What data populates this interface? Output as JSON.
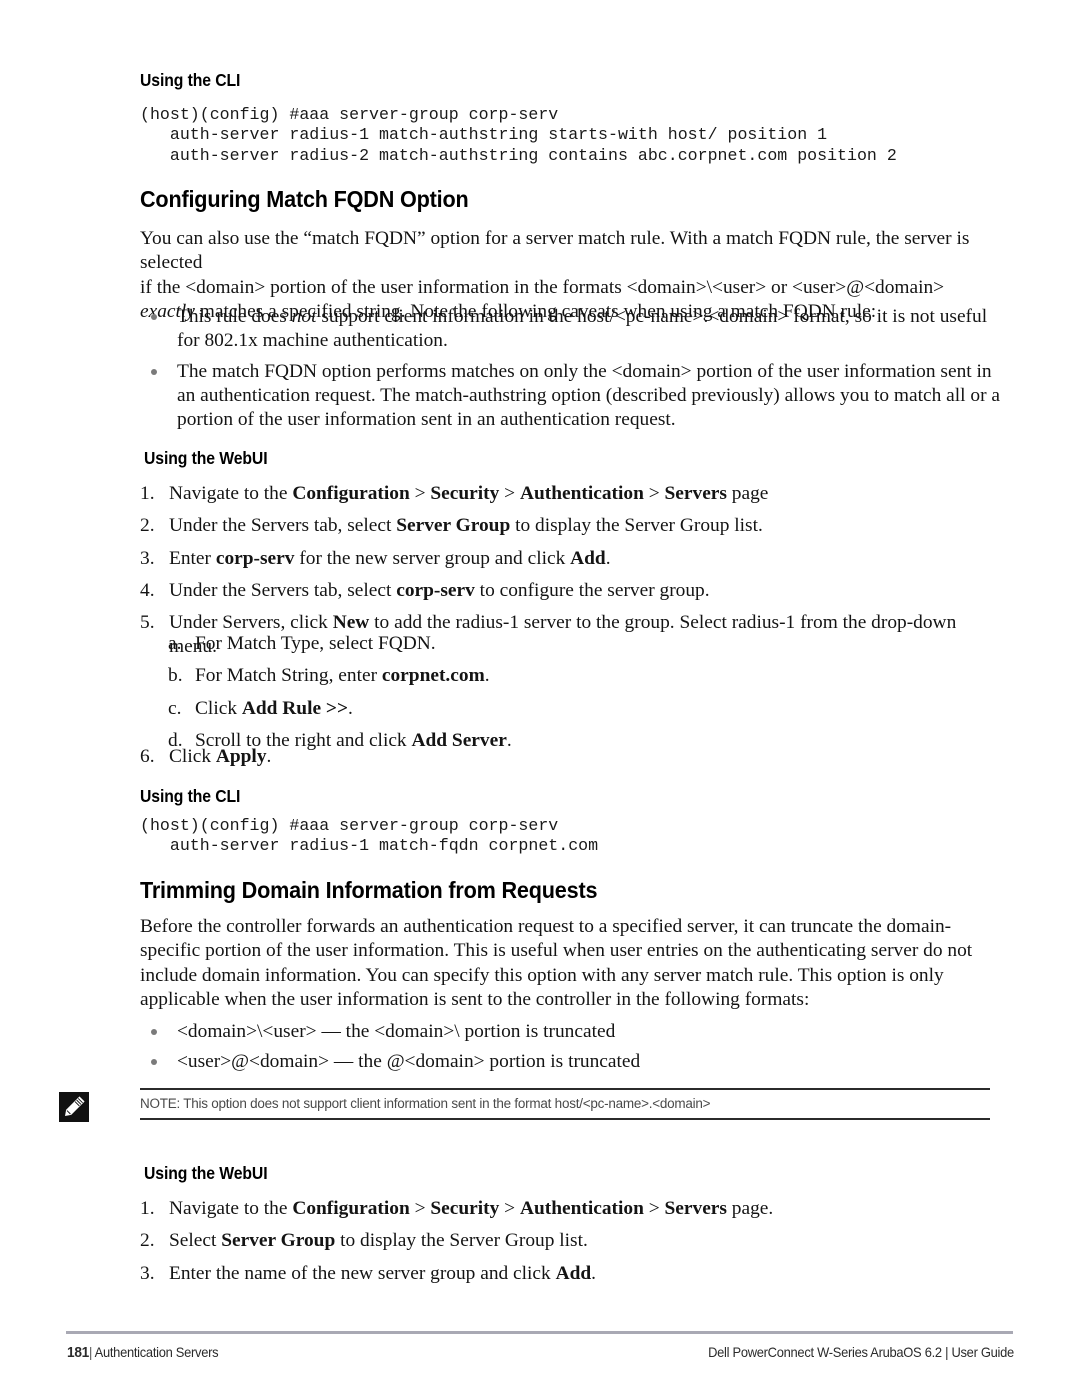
{
  "document": {
    "sections": [
      {
        "id": "cli-1",
        "heading": "Using the CLI",
        "code": "(host)(config) #aaa server-group corp-serv\n   auth-server radius-1 match-authstring starts-with host/ position 1\n   auth-server radius-2 match-authstring contains abc.corpnet.com position 2"
      },
      {
        "id": "fqdn",
        "heading": "Configuring Match FQDN Option",
        "intro_line1": "You can also use the “match FQDN” option for a server match rule. With a match FQDN rule, the server is selected",
        "intro_line2": "if the <domain> portion of the user information in the formats <domain>\\<user> or <user>@<domain>",
        "intro_line3_italic": "exactly",
        "intro_line3_rest": " matches a specified string. Note the following caveats when using a match FQDN rule:",
        "bullets": [
          {
            "pre": "This rule does ",
            "italic": "not",
            "post": " support client information in the host/<pc-name>.<domain> format, so it is not useful for 802.1x machine authentication."
          },
          {
            "pre": "The match FQDN option performs matches on only the <domain> portion of the user information sent in an authentication request. The match-authstring option (described previously) allows you to match all or a portion of the user information sent in an authentication request.",
            "italic": "",
            "post": ""
          }
        ]
      },
      {
        "id": "webui-1",
        "heading": "Using the WebUI",
        "steps": [
          {
            "marker": "1.",
            "parts": [
              {
                "t": "Navigate to the ",
                "s": "n"
              },
              {
                "t": "Configuration",
                "s": "b"
              },
              {
                "t": " > ",
                "s": "n"
              },
              {
                "t": "Security",
                "s": "b"
              },
              {
                "t": " > ",
                "s": "n"
              },
              {
                "t": "Authentication",
                "s": "b"
              },
              {
                "t": " > ",
                "s": "n"
              },
              {
                "t": "Servers",
                "s": "b"
              },
              {
                "t": " page",
                "s": "n"
              }
            ]
          },
          {
            "marker": "2.",
            "parts": [
              {
                "t": "Under the Servers tab, select ",
                "s": "n"
              },
              {
                "t": "Server Group",
                "s": "b"
              },
              {
                "t": " to display the Server Group list.",
                "s": "n"
              }
            ]
          },
          {
            "marker": "3.",
            "parts": [
              {
                "t": "Enter ",
                "s": "n"
              },
              {
                "t": "corp-serv",
                "s": "b"
              },
              {
                "t": " for the new server group and click ",
                "s": "n"
              },
              {
                "t": "Add",
                "s": "b"
              },
              {
                "t": ".",
                "s": "n"
              }
            ]
          },
          {
            "marker": "4.",
            "parts": [
              {
                "t": "Under the Servers tab, select ",
                "s": "n"
              },
              {
                "t": "corp-serv",
                "s": "b"
              },
              {
                "t": " to configure the server group.",
                "s": "n"
              }
            ]
          },
          {
            "marker": "5.",
            "parts": [
              {
                "t": "Under Servers, click ",
                "s": "n"
              },
              {
                "t": "New",
                "s": "b"
              },
              {
                "t": " to add the radius-1 server to the group. Select radius-1 from the drop-down menu.",
                "s": "n"
              }
            ]
          }
        ],
        "substeps": [
          {
            "marker": "a.",
            "parts": [
              {
                "t": "For Match Type, select ",
                "s": "n"
              },
              {
                "t": "FQDN",
                "s": "n"
              },
              {
                "t": ".",
                "s": "n"
              }
            ]
          },
          {
            "marker": "b.",
            "parts": [
              {
                "t": "For Match String, enter ",
                "s": "n"
              },
              {
                "t": "corpnet.com",
                "s": "b"
              },
              {
                "t": ".",
                "s": "n"
              }
            ]
          },
          {
            "marker": "c.",
            "parts": [
              {
                "t": "Click ",
                "s": "n"
              },
              {
                "t": "Add Rule >>",
                "s": "b"
              },
              {
                "t": ".",
                "s": "n"
              }
            ]
          },
          {
            "marker": "d.",
            "parts": [
              {
                "t": "Scroll to the right and click ",
                "s": "n"
              },
              {
                "t": "Add Server",
                "s": "b"
              },
              {
                "t": ".",
                "s": "n"
              }
            ]
          }
        ],
        "last_step": {
          "marker": "6.",
          "parts": [
            {
              "t": "Click ",
              "s": "n"
            },
            {
              "t": "Apply",
              "s": "b"
            },
            {
              "t": ".",
              "s": "n"
            }
          ]
        }
      },
      {
        "id": "cli-2",
        "heading": "Using the CLI",
        "code": "(host)(config) #aaa server-group corp-serv\n   auth-server radius-1 match-fqdn corpnet.com"
      },
      {
        "id": "trimming",
        "heading": "Trimming Domain Information from Requests",
        "intro": "Before the controller forwards an authentication request to a specified server, it can truncate the domain-specific portion of the user information. This is useful when user entries on the authenticating server do not include domain information. You can specify this option with any server match rule. This option is only applicable when the user information is sent to the controller in the following formats:",
        "bullets": [
          "<domain>\\<user> — the <domain>\\ portion is truncated",
          "<user>@<domain> — the @<domain> portion is truncated"
        ]
      },
      {
        "id": "webui-2",
        "heading": "Using the WebUI",
        "steps": [
          {
            "marker": "1.",
            "parts": [
              {
                "t": "Navigate to the ",
                "s": "n"
              },
              {
                "t": "Configuration",
                "s": "b"
              },
              {
                "t": " > ",
                "s": "n"
              },
              {
                "t": "Security",
                "s": "b"
              },
              {
                "t": " > ",
                "s": "n"
              },
              {
                "t": "Authentication",
                "s": "b"
              },
              {
                "t": " > ",
                "s": "n"
              },
              {
                "t": "Servers",
                "s": "b"
              },
              {
                "t": " page.",
                "s": "n"
              }
            ]
          },
          {
            "marker": "2.",
            "parts": [
              {
                "t": "Select ",
                "s": "n"
              },
              {
                "t": "Server Group",
                "s": "b"
              },
              {
                "t": " to display the Server Group list.",
                "s": "n"
              }
            ]
          },
          {
            "marker": "3.",
            "parts": [
              {
                "t": "Enter the name of the new server group and click ",
                "s": "n"
              },
              {
                "t": "Add",
                "s": "b"
              },
              {
                "t": ".",
                "s": "n"
              }
            ]
          }
        ]
      }
    ],
    "note": {
      "icon": "note-pencil-icon",
      "text": "NOTE: This option does not support client information sent in the format host/<pc-name>.<domain>"
    },
    "footer": {
      "page_number": "181",
      "separator": "|",
      "chapter": "Authentication Servers",
      "product": "Dell PowerConnect W-Series ArubaOS 6.2 | User Guide"
    }
  }
}
